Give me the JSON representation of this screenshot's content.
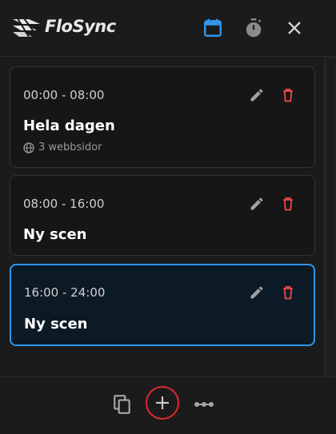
{
  "app": {
    "name": "FloSync"
  },
  "header": {
    "icons": [
      "calendar-icon",
      "timer-icon",
      "close-icon"
    ],
    "active_color": "#3196e8"
  },
  "scenes": [
    {
      "time": "00:00 - 08:00",
      "title": "Hela dagen",
      "meta": "3 webbsidor",
      "selected": false
    },
    {
      "time": "08:00 - 16:00",
      "title": "Ny scen",
      "meta": "",
      "selected": false
    },
    {
      "time": "16:00 - 24:00",
      "title": "Ny scen",
      "meta": "",
      "selected": true
    }
  ],
  "footer": {
    "icons": [
      "copy-icon",
      "add-icon",
      "more-icon"
    ],
    "highlight_color": "#e0282e"
  },
  "colors": {
    "delete": "#f0474a",
    "edit": "#a0a0a0"
  }
}
